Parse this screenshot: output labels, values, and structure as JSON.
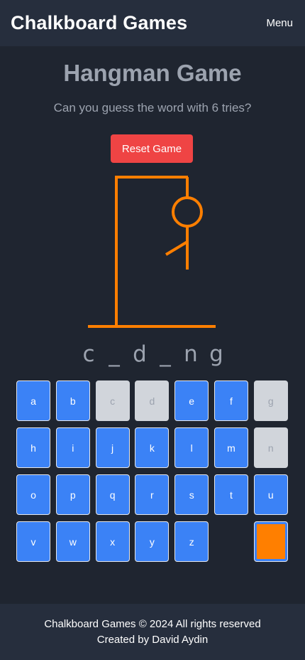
{
  "header": {
    "brand": "Chalkboard Games",
    "menu_label": "Menu"
  },
  "game": {
    "title": "Hangman Game",
    "subtitle": "Can you guess the word with 6 tries?",
    "reset_label": "Reset Game",
    "word_display": [
      "c",
      "_",
      "d",
      "_",
      "n",
      "g"
    ],
    "wrong_guesses": 3
  },
  "keyboard": {
    "keys": [
      {
        "letter": "a",
        "used": false
      },
      {
        "letter": "b",
        "used": false
      },
      {
        "letter": "c",
        "used": true
      },
      {
        "letter": "d",
        "used": true
      },
      {
        "letter": "e",
        "used": false
      },
      {
        "letter": "f",
        "used": false
      },
      {
        "letter": "g",
        "used": true
      },
      {
        "letter": "h",
        "used": false
      },
      {
        "letter": "i",
        "used": false
      },
      {
        "letter": "j",
        "used": false
      },
      {
        "letter": "k",
        "used": false
      },
      {
        "letter": "l",
        "used": false
      },
      {
        "letter": "m",
        "used": false
      },
      {
        "letter": "n",
        "used": true
      },
      {
        "letter": "o",
        "used": false
      },
      {
        "letter": "p",
        "used": false
      },
      {
        "letter": "q",
        "used": false
      },
      {
        "letter": "r",
        "used": false
      },
      {
        "letter": "s",
        "used": false
      },
      {
        "letter": "t",
        "used": false
      },
      {
        "letter": "u",
        "used": false
      },
      {
        "letter": "v",
        "used": false
      },
      {
        "letter": "w",
        "used": false
      },
      {
        "letter": "x",
        "used": false
      },
      {
        "letter": "y",
        "used": false
      },
      {
        "letter": "z",
        "used": false
      }
    ],
    "hint_color": "#ff7f00"
  },
  "footer": {
    "line1": "Chalkboard Games © 2024 All rights reserved",
    "line2": "Created by David Aydin"
  },
  "colors": {
    "background": "#1f2530",
    "bar": "#262e3d",
    "gallows": "#ff7f00",
    "key": "#3b82f6",
    "key_used": "#d1d5db",
    "reset": "#ef4444"
  }
}
